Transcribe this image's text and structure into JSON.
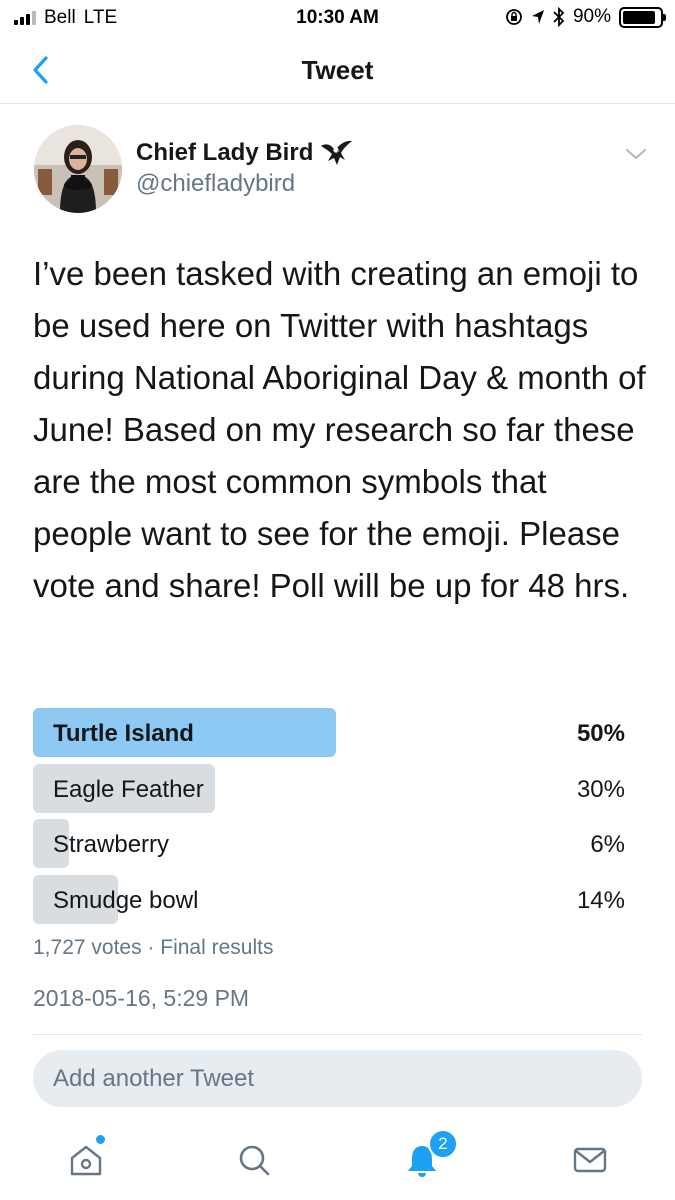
{
  "status_bar": {
    "carrier": "Bell",
    "network": "LTE",
    "time": "10:30 AM",
    "battery": "90%"
  },
  "nav": {
    "title": "Tweet"
  },
  "tweet": {
    "author_name": "Chief Lady Bird",
    "author_handle": "@chiefladybird",
    "text": "I’ve been tasked with creating an emoji to be used here on Twitter with hashtags during National Aboriginal Day & month of June! Based on my research so far these are the most common symbols that people want to see for the emoji. Please vote and share! Poll will be up for 48 hrs.",
    "timestamp": "2018-05-16, 5:29 PM"
  },
  "poll": {
    "options": [
      {
        "label": "Turtle Island",
        "pct_text": "50%",
        "value": 0.5,
        "winner": true
      },
      {
        "label": "Eagle Feather",
        "pct_text": "30%",
        "value": 0.3,
        "winner": false
      },
      {
        "label": "Strawberry",
        "pct_text": "6%",
        "value": 0.06,
        "winner": false
      },
      {
        "label": "Smudge bowl",
        "pct_text": "14%",
        "value": 0.14,
        "winner": false
      }
    ],
    "meta": "1,727 votes · Final results"
  },
  "reply": {
    "placeholder": "Add another Tweet"
  },
  "tabbar": {
    "notifications_count": "2"
  },
  "colors": {
    "accent": "#1da1f2",
    "winner_bar": "#8ec9f4",
    "bar": "#d8dde2",
    "secondary_text": "#657786"
  },
  "icons": [
    "back-chevron-icon",
    "eagle-emoji-icon",
    "chevron-down-icon",
    "home-icon",
    "search-icon",
    "bell-icon",
    "mail-icon"
  ]
}
